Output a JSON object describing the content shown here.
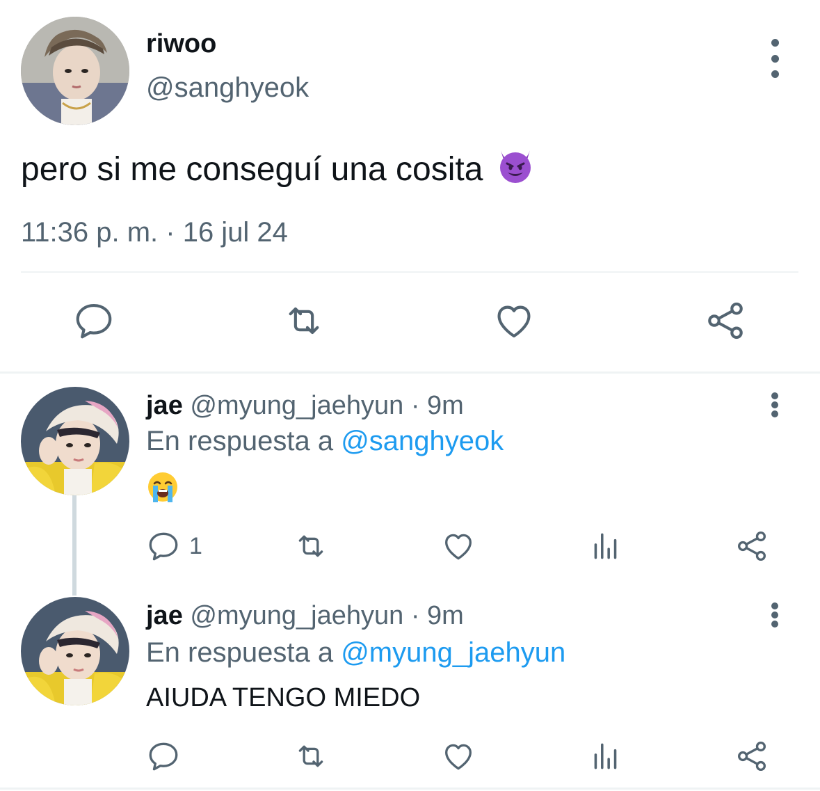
{
  "colors": {
    "text": "#0f1419",
    "secondary": "#536471",
    "link": "#1d9bf0",
    "divider": "#eff3f4"
  },
  "tweet": {
    "display_name": "riwoo",
    "handle": "@sanghyeok",
    "text": "pero si me conseguí una cosita",
    "emoji": "smiling-face-with-horns",
    "timestamp": "11:36 p. m. · 16 jul 24",
    "actions": [
      "reply-icon",
      "retweet-icon",
      "like-icon",
      "share-icon"
    ]
  },
  "replies": [
    {
      "display_name": "jae",
      "handle_time": "@myung_jaehyun · 9m",
      "reply_prefix": "En respuesta a",
      "reply_to": "@sanghyeok",
      "text": "",
      "emoji": "loudly-crying-face",
      "reply_count": "1",
      "actions": [
        "reply-icon",
        "retweet-icon",
        "like-icon",
        "views-icon",
        "share-icon"
      ]
    },
    {
      "display_name": "jae",
      "handle_time": "@myung_jaehyun · 9m",
      "reply_prefix": "En respuesta a",
      "reply_to": "@myung_jaehyun",
      "text": "AIUDA TENGO MIEDO",
      "reply_count": "",
      "actions": [
        "reply-icon",
        "retweet-icon",
        "like-icon",
        "views-icon",
        "share-icon"
      ]
    }
  ]
}
